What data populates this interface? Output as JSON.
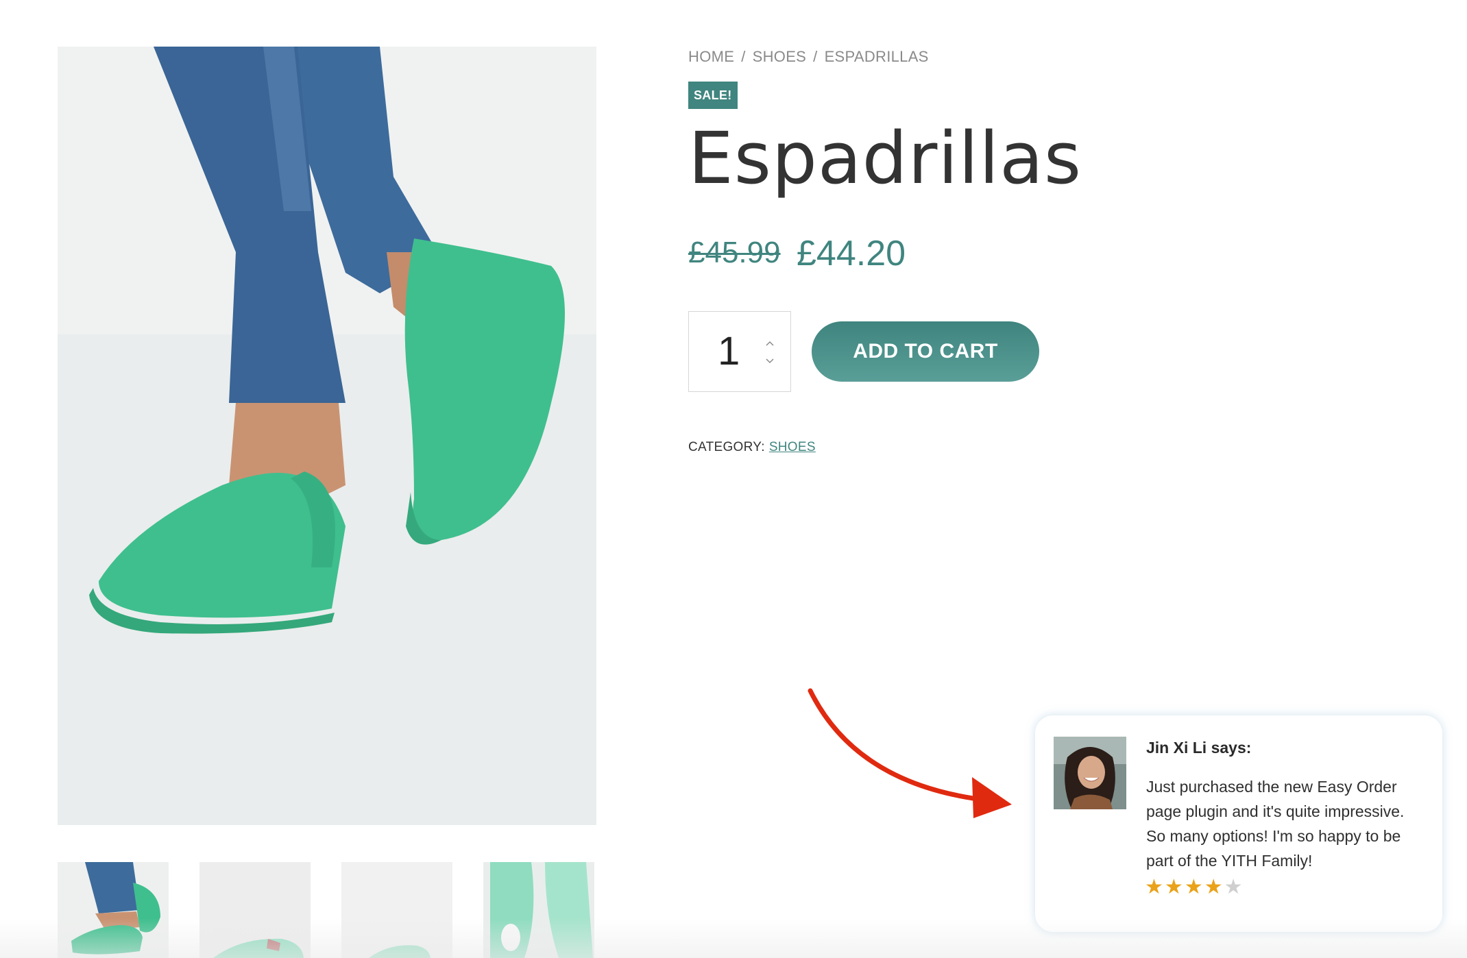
{
  "breadcrumb": {
    "home": "HOME",
    "sep1": "/",
    "shoes": "SHOES",
    "sep2": "/",
    "current": "ESPADRILLAS"
  },
  "product": {
    "badge": "SALE!",
    "title": "Espadrillas",
    "price_old": "£45.99",
    "price_new": "£44.20",
    "quantity": "1",
    "qty_up_icon": "chevron-up-icon",
    "qty_down_icon": "chevron-down-icon",
    "add_to_cart": "ADD TO CART",
    "category_label": "CATEGORY:",
    "category_link": "SHOES"
  },
  "gallery": {
    "thumbnails": [
      "thumbnail-1",
      "thumbnail-2",
      "thumbnail-3",
      "thumbnail-4"
    ]
  },
  "review": {
    "name": "Jin Xi Li says:",
    "text": "Just purchased the new Easy Order page plugin and it's quite impressive. So many options! I'm so happy to be part of the YITH Family!",
    "rating": 4,
    "rating_max": 5
  },
  "colors": {
    "accent": "#40857f",
    "star": "#e9a21a",
    "arrow": "#e02a10",
    "shoe": "#3dbd8d",
    "denim": "#3f6a9a"
  }
}
